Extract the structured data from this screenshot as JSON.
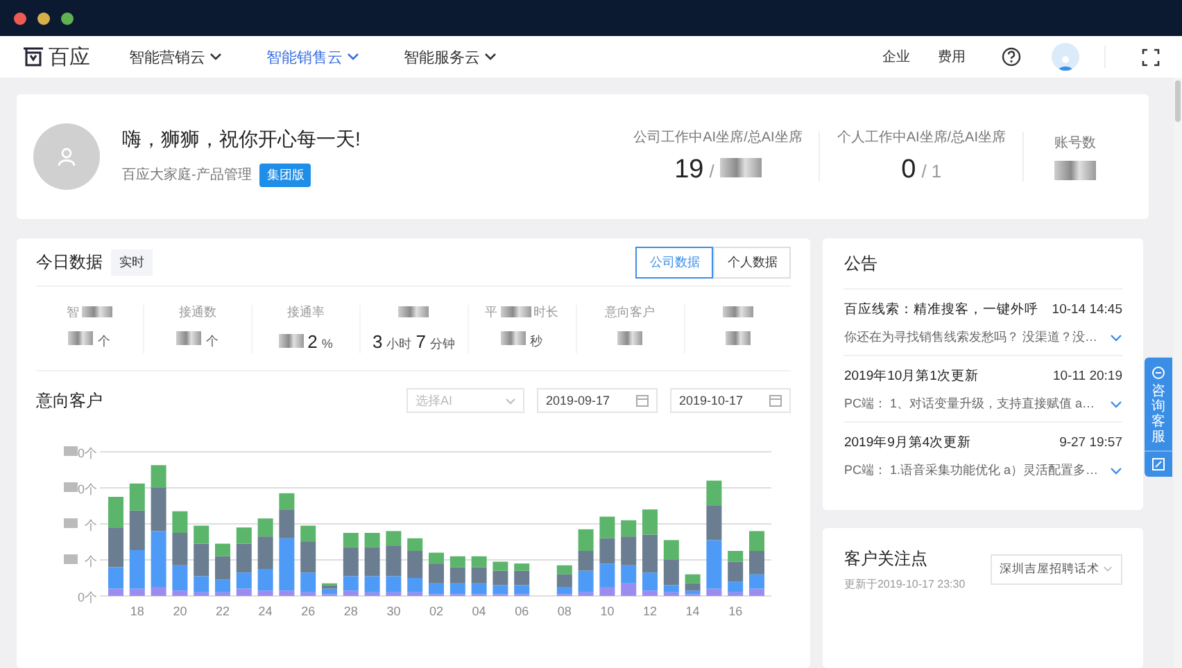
{
  "window": {
    "controls": [
      {
        "color": "#ee5b55"
      },
      {
        "color": "#d6b14a"
      },
      {
        "color": "#5fb24f"
      }
    ]
  },
  "nav": {
    "logo": "百应",
    "menus": [
      {
        "label": "智能营销云",
        "selected": false
      },
      {
        "label": "智能销售云",
        "selected": true
      },
      {
        "label": "智能服务云",
        "selected": false
      }
    ],
    "links": [
      "企业",
      "费用"
    ]
  },
  "welcome": {
    "greeting": "嗨，狮狮，祝你开心每一天!",
    "org": "百应大家庭-产品管理",
    "badge": "集团版"
  },
  "seat_stats": [
    {
      "label": "公司工作中AI坐席/总AI坐席",
      "value": "19",
      "suffix": "/",
      "blurred": true
    },
    {
      "label": "个人工作中AI坐席/总AI坐席",
      "value": "0",
      "suffix": "/ 1"
    },
    {
      "label": "账号数",
      "blurred": true
    }
  ],
  "today": {
    "title": "今日数据",
    "tag": "实时",
    "tabs": [
      {
        "label": "公司数据",
        "selected": true
      },
      {
        "label": "个人数据",
        "selected": false
      }
    ],
    "stats": [
      {
        "label": [
          {
            "kind": "text",
            "text": "智"
          },
          {
            "kind": "blur"
          }
        ],
        "value": [
          {
            "kind": "blur"
          },
          {
            "kind": "unit",
            "text": "个"
          }
        ]
      },
      {
        "label": [
          {
            "kind": "text",
            "text": "接通数"
          }
        ],
        "value": [
          {
            "kind": "blur"
          },
          {
            "kind": "unit",
            "text": "个"
          }
        ]
      },
      {
        "label": [
          {
            "kind": "text",
            "text": "接通率"
          }
        ],
        "value": [
          {
            "kind": "blur"
          },
          {
            "kind": "num",
            "text": "2"
          },
          {
            "kind": "unit",
            "text": "%"
          }
        ]
      },
      {
        "label": [
          {
            "kind": "blur"
          }
        ],
        "value": [
          {
            "kind": "num",
            "text": "3"
          },
          {
            "kind": "unit",
            "text": "小时"
          },
          {
            "kind": "num",
            "text": "7"
          },
          {
            "kind": "unit",
            "text": "分钟"
          }
        ]
      },
      {
        "label": [
          {
            "kind": "text",
            "text": "平"
          },
          {
            "kind": "blur"
          },
          {
            "kind": "text",
            "text": "时长"
          }
        ],
        "value": [
          {
            "kind": "blur"
          },
          {
            "kind": "unit",
            "text": "秒"
          }
        ]
      },
      {
        "label": [
          {
            "kind": "text",
            "text": "意向客户"
          }
        ],
        "value": [
          {
            "kind": "blur"
          }
        ]
      },
      {
        "label": [
          {
            "kind": "blur"
          }
        ],
        "value": [
          {
            "kind": "blur"
          }
        ]
      }
    ]
  },
  "intent": {
    "title": "意向客户",
    "select_placeholder": "选择AI",
    "date_from": "2019-09-17",
    "date_to": "2019-10-17",
    "x_labels": [
      "18",
      "20",
      "22",
      "24",
      "26",
      "28",
      "30",
      "02",
      "04",
      "06",
      "08",
      "10",
      "12",
      "14",
      "16"
    ],
    "y_labels": [
      "0个",
      "0个",
      "个",
      "个",
      "0个"
    ]
  },
  "notices": {
    "title": "公告",
    "items": [
      {
        "title": "百应线索：精准搜客，一键外呼",
        "time": "10-14 14:45",
        "summary": "你还在为寻找销售线索发愁吗？ 没渠道？没…"
      },
      {
        "title": "2019年10月第1次更新",
        "time": "10-11 20:19",
        "summary": "PC端： 1、对话变量升级，支持直接赋值 a…"
      },
      {
        "title": "2019年9月第4次更新",
        "time": "9-27 19:57",
        "summary": "PC端：  1.语音采集功能优化 a）灵活配置多…"
      }
    ]
  },
  "focus": {
    "title": "客户关注点",
    "updated": "更新于2019-10-17 23:30",
    "script": "深圳吉屋招聘话术"
  },
  "side_tab": {
    "text": "咨询客服"
  }
}
